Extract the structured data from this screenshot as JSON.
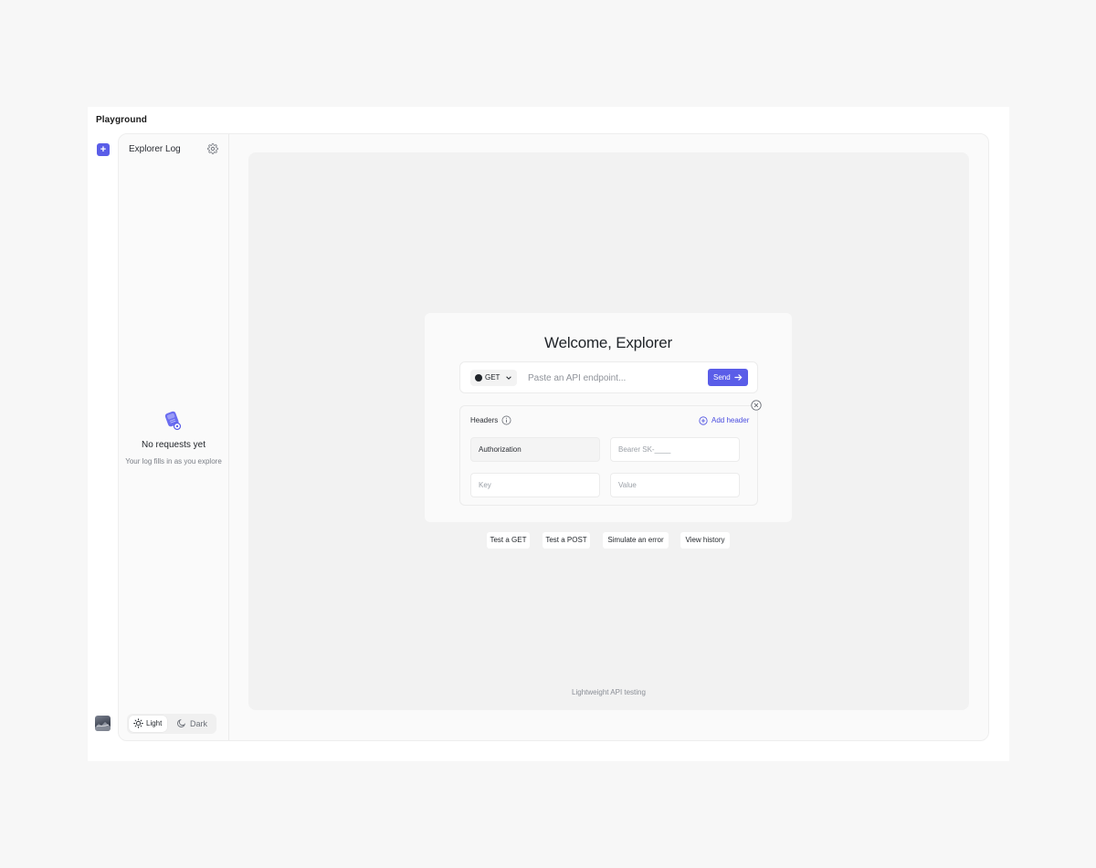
{
  "window": {
    "title": "Playground"
  },
  "rail": {
    "add_label": "+"
  },
  "sidebar": {
    "title": "Explorer Log",
    "empty_title": "No requests yet",
    "empty_subtitle": "Your log fills in as you explore",
    "theme": {
      "light_label": "Light",
      "dark_label": "Dark",
      "selected": "Light"
    }
  },
  "main": {
    "welcome_title": "Welcome, Explorer",
    "request": {
      "method": "GET",
      "endpoint_placeholder": "Paste an API endpoint...",
      "send_label": "Send"
    },
    "headers": {
      "label": "Headers",
      "add_label": "Add header",
      "rows": [
        {
          "key": "Authorization",
          "value_placeholder": "Bearer SK-____"
        },
        {
          "key_placeholder": "Key",
          "value_placeholder": "Value"
        }
      ]
    },
    "quick_actions": [
      "Test a GET",
      "Test a POST",
      "Simulate an error",
      "View history"
    ],
    "footer": "Lightweight API testing"
  },
  "colors": {
    "accent": "#5a5de8",
    "background": "#f7f7f7",
    "panel": "#f2f2f2",
    "card": "#fafafa"
  }
}
